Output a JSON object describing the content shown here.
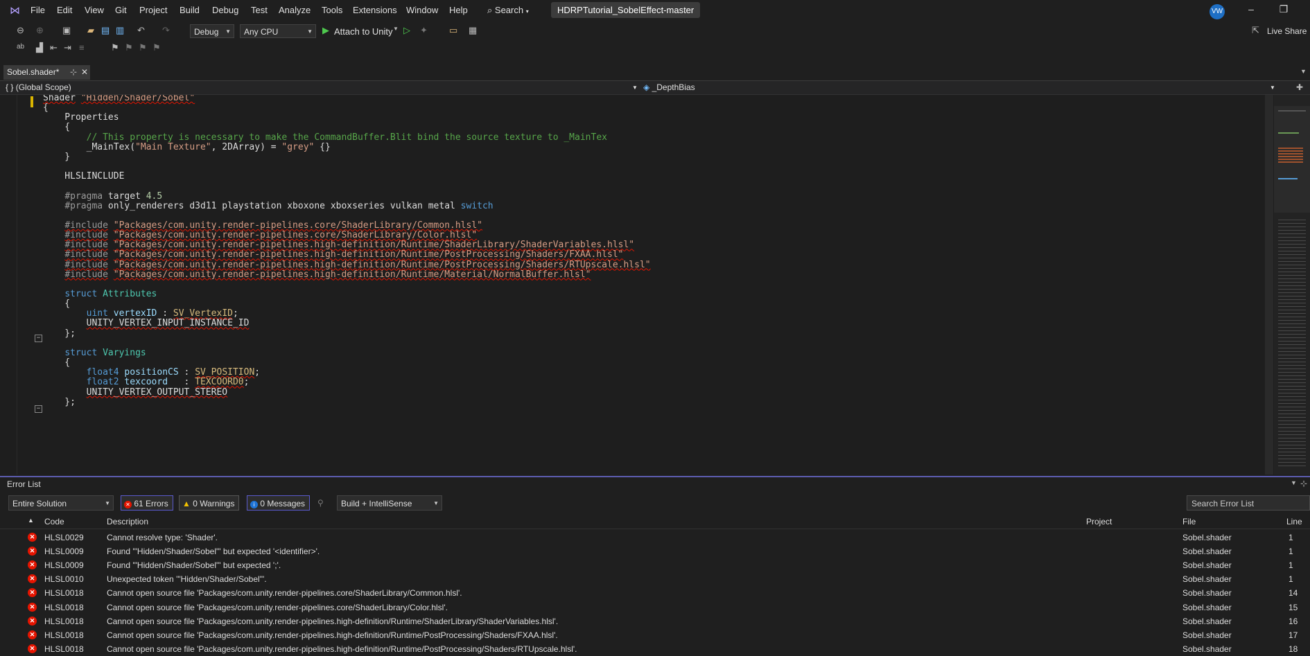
{
  "app": {
    "menu": [
      "File",
      "Edit",
      "View",
      "Git",
      "Project",
      "Build",
      "Debug",
      "Test",
      "Analyze",
      "Tools",
      "Extensions",
      "Window",
      "Help"
    ],
    "search_label": "Search",
    "solution_name": "HDRPTutorial_SobelEffect-master",
    "avatar_initials": "VW"
  },
  "toolbar": {
    "config": "Debug",
    "platform": "Any CPU",
    "attach_label": "Attach to Unity",
    "live_share": "Live Share"
  },
  "tab": {
    "label": "Sobel.shader*"
  },
  "navbar": {
    "scope": "(Global Scope)",
    "member": "_DepthBias"
  },
  "editor": {
    "lines": [
      {
        "kind": "shader",
        "t1": "Shader",
        "t2": "\"Hidden/Shader/Sobel\""
      },
      {
        "kind": "plain",
        "text": "{"
      },
      {
        "kind": "plain",
        "text": "    Properties"
      },
      {
        "kind": "plain",
        "text": "    {"
      },
      {
        "kind": "comment",
        "text": "        // This property is necessary to make the CommandBuffer.Blit bind the source texture to _MainTex"
      },
      {
        "kind": "prop",
        "text": "        _MainTex(\"Main Texture\", 2DArray) = \"grey\" {}"
      },
      {
        "kind": "plain",
        "text": "    }"
      },
      {
        "kind": "plain",
        "text": ""
      },
      {
        "kind": "plain",
        "text": "    HLSLINCLUDE"
      },
      {
        "kind": "plain",
        "text": ""
      },
      {
        "kind": "pragma",
        "text": "    #pragma target 4.5"
      },
      {
        "kind": "pragma",
        "text": "    #pragma only_renderers d3d11 playstation xboxone xboxseries vulkan metal switch"
      },
      {
        "kind": "plain",
        "text": ""
      },
      {
        "kind": "include",
        "text": "    #include \"Packages/com.unity.render-pipelines.core/ShaderLibrary/Common.hlsl\""
      },
      {
        "kind": "include",
        "text": "    #include \"Packages/com.unity.render-pipelines.core/ShaderLibrary/Color.hlsl\""
      },
      {
        "kind": "include",
        "text": "    #include \"Packages/com.unity.render-pipelines.high-definition/Runtime/ShaderLibrary/ShaderVariables.hlsl\""
      },
      {
        "kind": "include",
        "text": "    #include \"Packages/com.unity.render-pipelines.high-definition/Runtime/PostProcessing/Shaders/FXAA.hlsl\""
      },
      {
        "kind": "include",
        "text": "    #include \"Packages/com.unity.render-pipelines.high-definition/Runtime/PostProcessing/Shaders/RTUpscale.hlsl\""
      },
      {
        "kind": "include",
        "text": "    #include \"Packages/com.unity.render-pipelines.high-definition/Runtime/Material/NormalBuffer.hlsl\""
      },
      {
        "kind": "plain",
        "text": ""
      },
      {
        "kind": "struct",
        "text": "    struct Attributes"
      },
      {
        "kind": "plain",
        "text": "    {"
      },
      {
        "kind": "plain",
        "text": "        uint vertexID : SV_VertexID;"
      },
      {
        "kind": "plain",
        "text": "        UNITY_VERTEX_INPUT_INSTANCE_ID"
      },
      {
        "kind": "plain",
        "text": "    };"
      },
      {
        "kind": "plain",
        "text": ""
      },
      {
        "kind": "struct",
        "text": "    struct Varyings"
      },
      {
        "kind": "plain",
        "text": "    {"
      },
      {
        "kind": "plain",
        "text": "        float4 positionCS : SV_POSITION;"
      },
      {
        "kind": "plain",
        "text": "        float2 texcoord   : TEXCOORD0;"
      },
      {
        "kind": "plain",
        "text": "        UNITY_VERTEX_OUTPUT_STEREO"
      },
      {
        "kind": "plain",
        "text": "    };"
      }
    ]
  },
  "errors": {
    "title": "Error List",
    "scope": "Entire Solution",
    "errors_btn": "61 Errors",
    "warnings_btn": "0 Warnings",
    "messages_btn": "0 Messages",
    "build_filter": "Build + IntelliSense",
    "search_placeholder": "Search Error List",
    "columns": {
      "code": "Code",
      "desc": "Description",
      "project": "Project",
      "file": "File",
      "line": "Line"
    },
    "rows": [
      {
        "code": "HLSL0029",
        "desc": "Cannot resolve type: 'Shader'.",
        "file": "Sobel.shader",
        "line": "1"
      },
      {
        "code": "HLSL0009",
        "desc": "Found '\"Hidden/Shader/Sobel\"' but expected '<identifier>'.",
        "file": "Sobel.shader",
        "line": "1"
      },
      {
        "code": "HLSL0009",
        "desc": "Found '\"Hidden/Shader/Sobel\"' but expected ';'.",
        "file": "Sobel.shader",
        "line": "1"
      },
      {
        "code": "HLSL0010",
        "desc": "Unexpected token '\"Hidden/Shader/Sobel\"'.",
        "file": "Sobel.shader",
        "line": "1"
      },
      {
        "code": "HLSL0018",
        "desc": "Cannot open source file 'Packages/com.unity.render-pipelines.core/ShaderLibrary/Common.hlsl'.",
        "file": "Sobel.shader",
        "line": "14"
      },
      {
        "code": "HLSL0018",
        "desc": "Cannot open source file 'Packages/com.unity.render-pipelines.core/ShaderLibrary/Color.hlsl'.",
        "file": "Sobel.shader",
        "line": "15"
      },
      {
        "code": "HLSL0018",
        "desc": "Cannot open source file 'Packages/com.unity.render-pipelines.high-definition/Runtime/ShaderLibrary/ShaderVariables.hlsl'.",
        "file": "Sobel.shader",
        "line": "16"
      },
      {
        "code": "HLSL0018",
        "desc": "Cannot open source file 'Packages/com.unity.render-pipelines.high-definition/Runtime/PostProcessing/Shaders/FXAA.hlsl'.",
        "file": "Sobel.shader",
        "line": "17"
      },
      {
        "code": "HLSL0018",
        "desc": "Cannot open source file 'Packages/com.unity.render-pipelines.high-definition/Runtime/PostProcessing/Shaders/RTUpscale.hlsl'.",
        "file": "Sobel.shader",
        "line": "18"
      }
    ]
  }
}
